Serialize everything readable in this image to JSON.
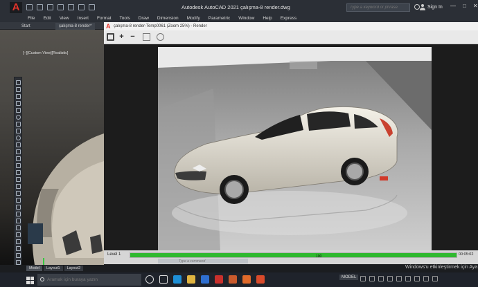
{
  "titlebar": {
    "window_title": "Autodesk AutoCAD 2021   çalışma-8 render.dwg",
    "search_placeholder": "Type a keyword or phrase",
    "sign_in": "Sign In",
    "controls": [
      "—",
      "□",
      "✕"
    ]
  },
  "menu": [
    "File",
    "Edit",
    "View",
    "Insert",
    "Format",
    "Tools",
    "Draw",
    "Dimension",
    "Modify",
    "Parametric",
    "Window",
    "Help",
    "Express"
  ],
  "doc_tabs": {
    "start": "Start",
    "drawing": "çalışma-8 render*"
  },
  "viewport": {
    "label": "[−][Custom View][Realistic]"
  },
  "render_window": {
    "title": "çalışma-8 render-Temp0061 (Zoom 25%) - Render",
    "level_label": "Level 1",
    "progress_percent": 100,
    "progress_text": "100",
    "elapsed_time": "00:05:02",
    "command_placeholder": "Type a command"
  },
  "layout_tabs": [
    "Model",
    "Layout1",
    "Layout2"
  ],
  "watermark": "Windows'u etkinleştirmek için Aya",
  "taskbar": {
    "search_placeholder": "Aramak için buraya yazın",
    "model_label": "MODEL"
  },
  "colors": {
    "accent_red": "#e5342b",
    "progress_green": "#2fb92f"
  }
}
